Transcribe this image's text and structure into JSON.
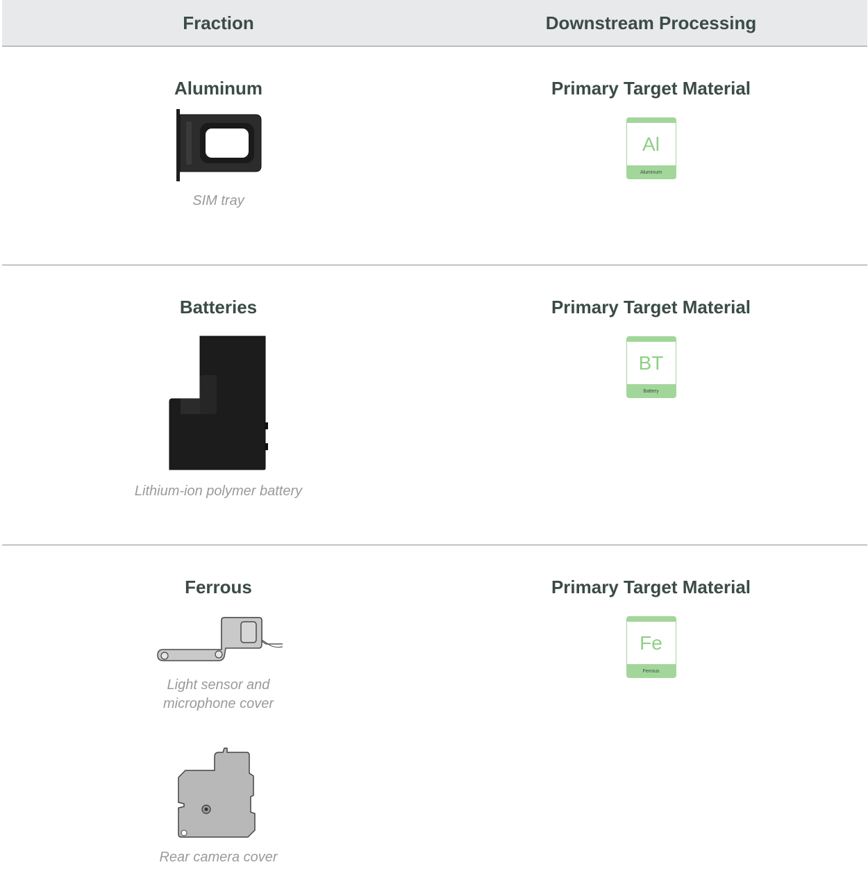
{
  "header": {
    "col_fraction": "Fraction",
    "col_processing": "Downstream Processing"
  },
  "rows": [
    {
      "fraction": "Aluminum",
      "parts": [
        {
          "caption": "SIM tray",
          "icon": "sim-tray-icon"
        }
      ],
      "processing": "Primary Target Material",
      "material": {
        "symbol": "Al",
        "name": "Aluminum"
      }
    },
    {
      "fraction": "Batteries",
      "parts": [
        {
          "caption": "Lithium-ion polymer battery",
          "icon": "battery-icon"
        }
      ],
      "processing": "Primary Target Material",
      "material": {
        "symbol": "BT",
        "name": "Battery"
      }
    },
    {
      "fraction": "Ferrous",
      "parts": [
        {
          "caption_line1": "Light sensor and",
          "caption_line2": "microphone cover",
          "icon": "light-sensor-cover-icon"
        },
        {
          "caption": "Rear camera cover",
          "icon": "rear-camera-cover-icon"
        }
      ],
      "processing": "Primary Target Material",
      "material": {
        "symbol": "Fe",
        "name": "Ferrous"
      }
    }
  ],
  "colors": {
    "heading": "#3b4b45",
    "tile_green": "#a3d69b",
    "header_bg": "#e8e9ea"
  }
}
